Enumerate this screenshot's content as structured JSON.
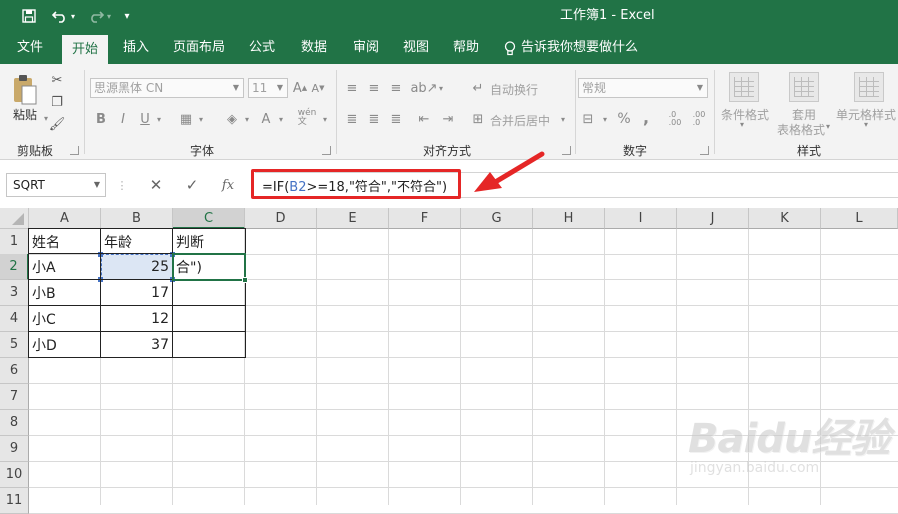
{
  "titlebar": {
    "title": "工作簿1  -  Excel"
  },
  "quick_access": {
    "save": "save-icon",
    "undo": "undo-icon",
    "redo": "redo-icon",
    "customize": "customize-icon"
  },
  "tabs": [
    "文件",
    "开始",
    "插入",
    "页面布局",
    "公式",
    "数据",
    "审阅",
    "视图",
    "帮助"
  ],
  "tell_me": "告诉我你想要做什么",
  "ribbon": {
    "clipboard": {
      "paste_label": "粘贴",
      "group_label": "剪贴板"
    },
    "font": {
      "font_name": "思源黑体 CN",
      "font_size": "11",
      "bold": "B",
      "italic": "I",
      "underline": "U",
      "group_label": "字体"
    },
    "alignment": {
      "wrap_text": "自动换行",
      "merge_center": "合并后居中",
      "group_label": "对齐方式"
    },
    "number": {
      "format": "常规",
      "percent": "%",
      "comma": ",",
      "group_label": "数字"
    },
    "styles": {
      "conditional": "条件格式",
      "table_line1": "套用",
      "table_line2": "表格格式",
      "cell_styles": "单元格样式",
      "group_label": "样式"
    }
  },
  "formula_bar": {
    "name_box": "SQRT",
    "cancel": "✕",
    "enter": "✓",
    "fx": "fx",
    "formula_prefix": "=IF(",
    "formula_ref": "B2",
    "formula_rest": ">=18,\"符合\",\"不符合\")"
  },
  "grid": {
    "columns": [
      "A",
      "B",
      "C",
      "D",
      "E",
      "F",
      "G",
      "H",
      "I",
      "J",
      "K",
      "L"
    ],
    "rows": [
      "1",
      "2",
      "3",
      "4",
      "5",
      "6",
      "7",
      "8",
      "9",
      "10",
      "11"
    ],
    "cells": {
      "A1": "姓名",
      "B1": "年龄",
      "C1": "判断",
      "A2": "小A",
      "B2": "25",
      "C2": "合\")",
      "A3": "小B",
      "B3": "17",
      "A4": "小C",
      "B4": "12",
      "A5": "小D",
      "B5": "37"
    }
  },
  "watermark": {
    "main": "Baidu经验",
    "sub": "jingyan.baidu.com"
  },
  "colors": {
    "accent": "#217346",
    "highlight_red": "#e52626",
    "reference_blue": "#4472c4"
  }
}
